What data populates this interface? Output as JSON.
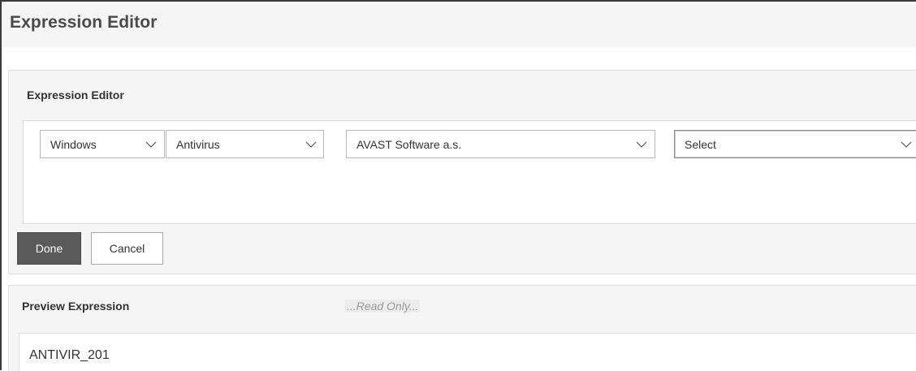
{
  "page": {
    "title": "Expression Editor"
  },
  "editor": {
    "heading": "Expression Editor",
    "selects": [
      {
        "selected": "Windows"
      },
      {
        "selected": "Antivirus"
      },
      {
        "selected": "AVAST Software a.s."
      },
      {
        "selected": "Select"
      }
    ],
    "chevron_icon": "chevron-down-icon"
  },
  "actions": {
    "done_label": "Done",
    "cancel_label": "Cancel"
  },
  "preview": {
    "heading": "Preview Expression",
    "readonly_note": "...Read Only...",
    "expression": "ANTIVIR_201"
  },
  "colors": {
    "done_button": "#5a5a5a",
    "panel_background": "#f5f5f5",
    "title_text": "#4a4a4a"
  }
}
